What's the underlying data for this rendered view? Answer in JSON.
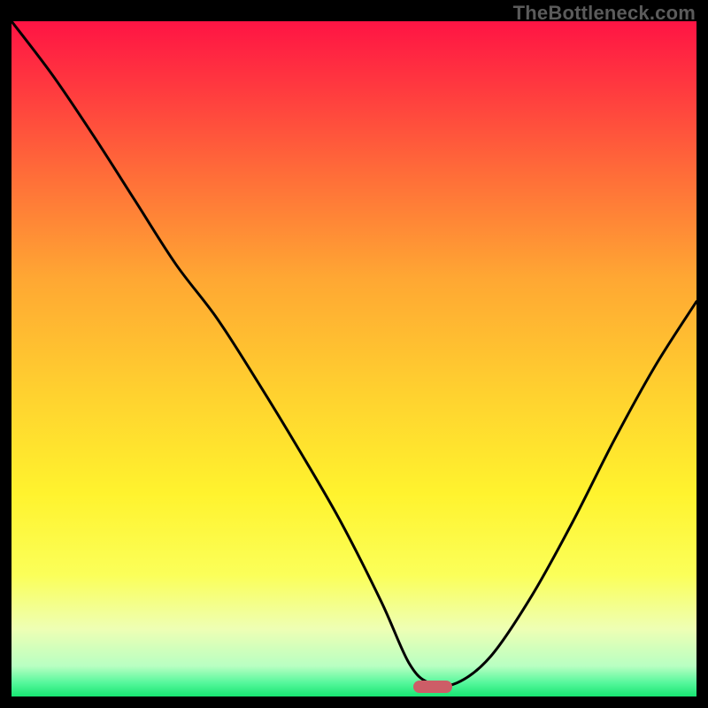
{
  "watermark": "TheBottleneck.com",
  "marker": {
    "cx_frac": 0.615,
    "cy_frac": 0.985
  },
  "gradient_stops": [
    {
      "offset": 0.0,
      "color": "#ff1444"
    },
    {
      "offset": 0.1,
      "color": "#ff3a3f"
    },
    {
      "offset": 0.22,
      "color": "#ff6a39"
    },
    {
      "offset": 0.38,
      "color": "#ffa733"
    },
    {
      "offset": 0.55,
      "color": "#ffd12f"
    },
    {
      "offset": 0.7,
      "color": "#fff32e"
    },
    {
      "offset": 0.82,
      "color": "#fbff59"
    },
    {
      "offset": 0.9,
      "color": "#eeffb4"
    },
    {
      "offset": 0.955,
      "color": "#b8ffc2"
    },
    {
      "offset": 0.98,
      "color": "#55f79b"
    },
    {
      "offset": 1.0,
      "color": "#17e672"
    }
  ],
  "chart_data": {
    "type": "line",
    "title": "",
    "xlabel": "",
    "ylabel": "",
    "xlim": [
      0,
      1
    ],
    "ylim": [
      0,
      1
    ],
    "note": "Axes unlabeled; values are normalized fractions of the plot area (x left→right, y bottom→top). Curve is a bottleneck V shape with minimum near x≈0.60.",
    "series": [
      {
        "name": "bottleneck-curve",
        "x": [
          0.0,
          0.06,
          0.12,
          0.18,
          0.24,
          0.3,
          0.36,
          0.42,
          0.48,
          0.54,
          0.58,
          0.61,
          0.65,
          0.7,
          0.76,
          0.82,
          0.88,
          0.94,
          1.0
        ],
        "y": [
          1.0,
          0.92,
          0.83,
          0.735,
          0.64,
          0.56,
          0.465,
          0.365,
          0.26,
          0.14,
          0.05,
          0.02,
          0.02,
          0.06,
          0.15,
          0.26,
          0.38,
          0.49,
          0.585
        ]
      }
    ],
    "marker": {
      "x": 0.615,
      "y": 0.015,
      "shape": "pill",
      "color": "#cd5d67"
    }
  }
}
